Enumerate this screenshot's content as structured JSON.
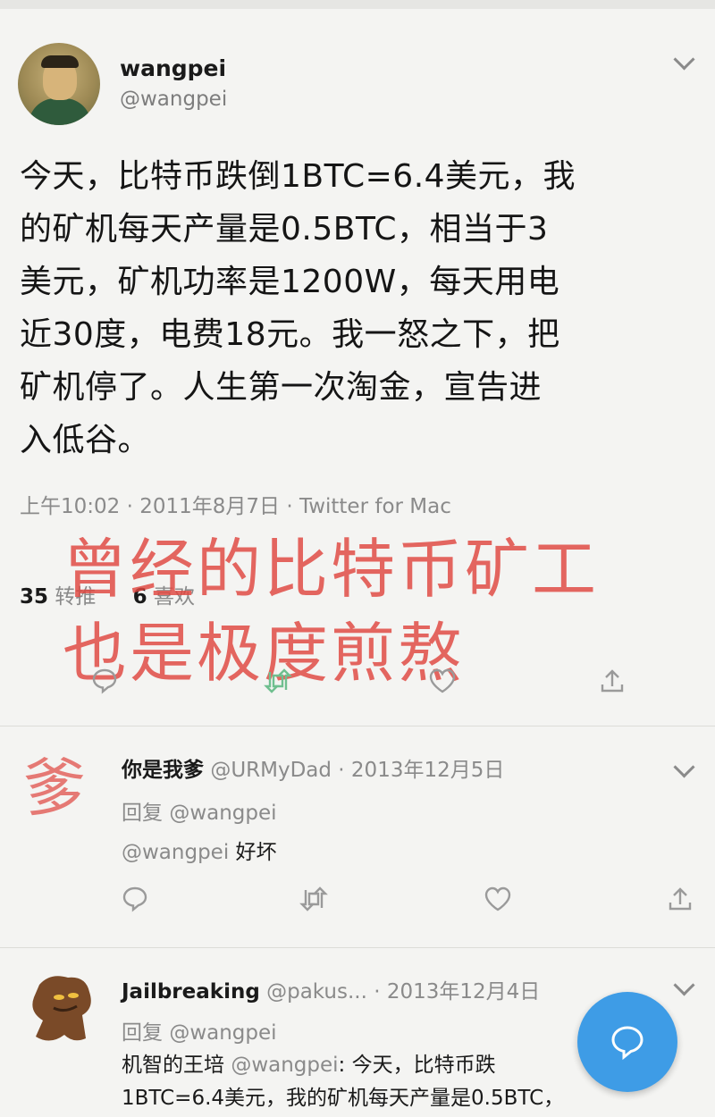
{
  "main_tweet": {
    "author_name": "wangpei",
    "author_handle": "@wangpei",
    "text_lines": [
      "今天，比特币跌倒1BTC=6.4美元，我",
      "的矿机每天产量是0.5BTC，相当于3",
      "美元，矿机功率是1200W，每天用电",
      "近30度，电费18元。我一怒之下，把",
      "矿机停了。人生第一次淘金，宣告进",
      "入低谷。"
    ],
    "meta": "上午10:02 · 2011年8月7日 · Twitter for Mac",
    "retweet_count": "35",
    "retweet_label": "转推",
    "like_count": "6",
    "like_label": "喜欢"
  },
  "overlay": {
    "line1": "曾经的比特币矿工",
    "line2": "也是极度煎熬",
    "avatar_char": "爹",
    "color": "#e0463f"
  },
  "reply1": {
    "author_name": "你是我爹",
    "handle_date": "@URMyDad · 2013年12月5日",
    "reply_prefix": "回复",
    "reply_to": "@wangpei",
    "mention": "@wangpei",
    "text": " 好坏"
  },
  "reply2": {
    "author_name": "Jailbreaking",
    "handle_date": "@pakus... · 2013年12月4日",
    "reply_prefix": "回复",
    "reply_to": "@wangpei",
    "line1_pre": "机智的王培 ",
    "line1_mention": "@wangpei",
    "line1_post": ": 今天，比特币跌",
    "line2": "1BTC=6.4美元，我的矿机每天产量是0.5BTC，"
  },
  "icons": {
    "action_bar": [
      "reply-icon",
      "retweet-icon",
      "like-icon",
      "share-icon"
    ],
    "more": "chevron-down-icon",
    "compose": "compose-tweet-icon"
  },
  "colors": {
    "accent": "#2f95e6",
    "muted": "#8a8a8a",
    "retweet_active": "#6fbf8f"
  }
}
